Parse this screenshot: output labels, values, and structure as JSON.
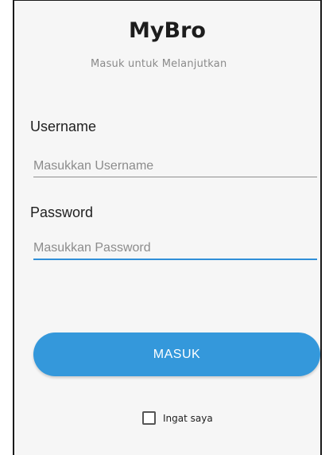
{
  "app": {
    "title": "MyBro",
    "subtitle": "Masuk untuk Melanjutkan"
  },
  "form": {
    "username": {
      "label": "Username",
      "placeholder": "Masukkan Username",
      "value": ""
    },
    "password": {
      "label": "Password",
      "placeholder": "Masukkan Password",
      "value": ""
    },
    "submit_label": "MASUK",
    "remember": {
      "label": "Ingat saya",
      "checked": false
    }
  },
  "colors": {
    "accent": "#3498db",
    "focused_underline": "#2f8fd8",
    "background": "#f6f6f6"
  }
}
